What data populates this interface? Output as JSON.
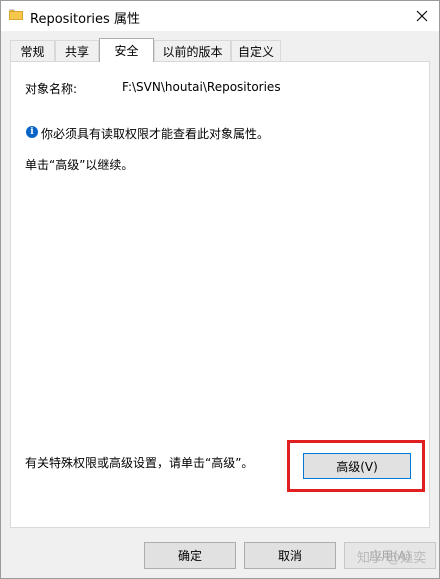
{
  "window": {
    "title": "Repositories 属性",
    "close_symbol": "✕"
  },
  "tabs": [
    {
      "label": "常规",
      "active": false
    },
    {
      "label": "共享",
      "active": false
    },
    {
      "label": "安全",
      "active": true
    },
    {
      "label": "以前的版本",
      "active": false
    },
    {
      "label": "自定义",
      "active": false
    }
  ],
  "security": {
    "object_name_label": "对象名称:",
    "object_name_value": "F:\\SVN\\houtai\\Repositories",
    "info_icon": "i",
    "permission_message": "你必须具有读取权限才能查看此对象属性。",
    "continue_message": "单击“高级”以继续。",
    "special_permissions_text": "有关特殊权限或高级设置，请单击“高级”。",
    "advanced_button": "高级(V)"
  },
  "footer": {
    "ok_button": "确定",
    "cancel_button": "取消",
    "apply_button": "应用(A)",
    "watermark": "知乎 @姮奕"
  },
  "colors": {
    "highlight": "#e02020",
    "info_icon": "#0a64c8",
    "focus_border": "#0078d7"
  }
}
